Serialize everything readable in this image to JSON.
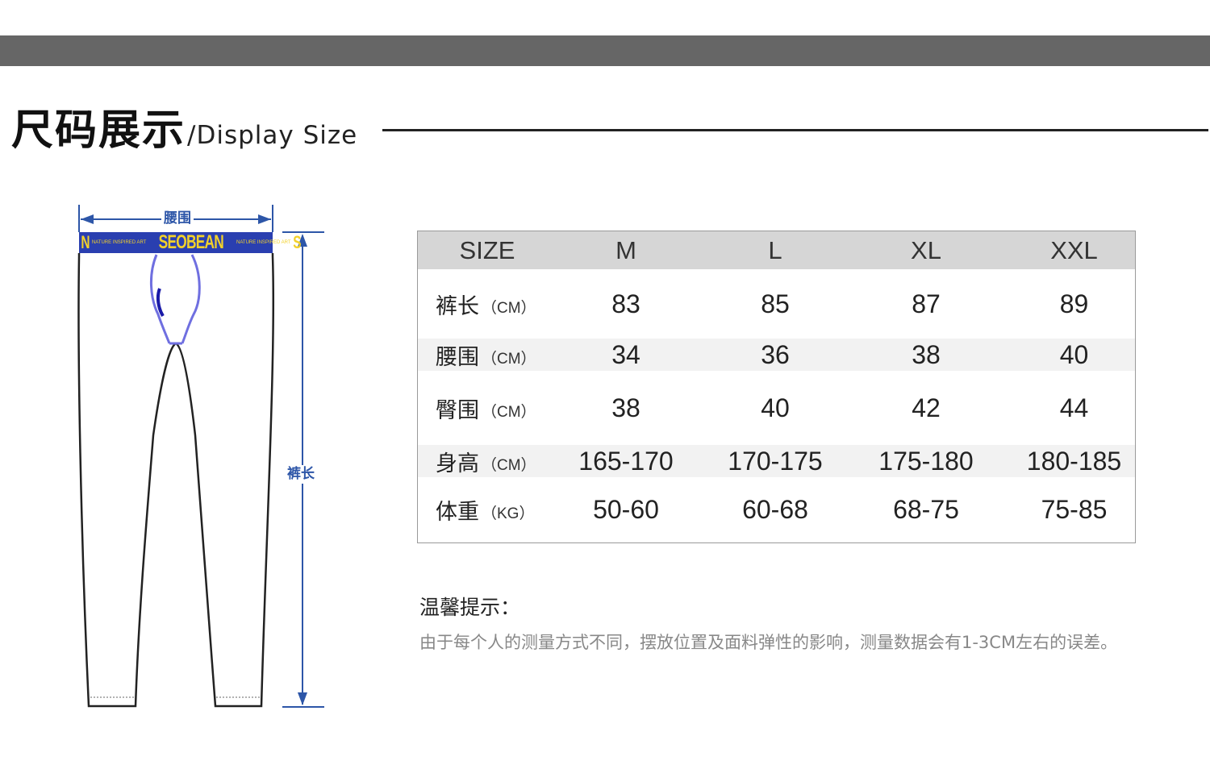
{
  "header": {
    "title_cn": "尺码展示",
    "title_en": "/Display Size"
  },
  "diagram": {
    "waist_label": "腰围",
    "length_label": "裤长",
    "band_brand": "SEOBEAN",
    "band_tagline": "NATURE INSPIRED ART",
    "band_left_letter": "N",
    "band_right_letter": "S",
    "accent_color": "#2d56a8",
    "band_color": "#2a3fb0"
  },
  "table": {
    "columns": [
      "SIZE",
      "M",
      "L",
      "XL",
      "XXL"
    ],
    "rows": [
      {
        "label": "裤长",
        "unit": "（CM）",
        "values": [
          "83",
          "85",
          "87",
          "89"
        ]
      },
      {
        "label": "腰围",
        "unit": "（CM）",
        "values": [
          "34",
          "36",
          "38",
          "40"
        ]
      },
      {
        "label": "臀围",
        "unit": "（CM）",
        "values": [
          "38",
          "40",
          "42",
          "44"
        ]
      },
      {
        "label": "身高",
        "unit": "（CM）",
        "values": [
          "165-170",
          "170-175",
          "175-180",
          "180-185"
        ]
      },
      {
        "label": "体重",
        "unit": "（KG）",
        "values": [
          "50-60",
          "60-68",
          "68-75",
          "75-85"
        ]
      }
    ]
  },
  "tips": {
    "title": "温馨提示：",
    "body": "由于每个人的测量方式不同，摆放位置及面料弹性的影响，测量数据会有1-3CM左右的误差。"
  }
}
